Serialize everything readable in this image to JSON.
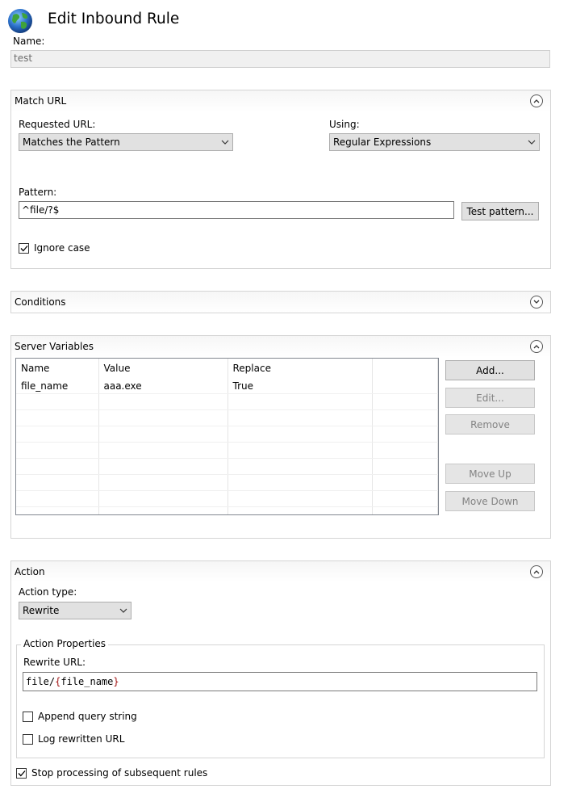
{
  "window": {
    "title": "Edit Inbound Rule",
    "icon": "globe-icon"
  },
  "name": {
    "label": "Name:",
    "value": "test"
  },
  "match_url": {
    "header": "Match URL",
    "requested_url_label": "Requested URL:",
    "requested_url_value": "Matches the Pattern",
    "using_label": "Using:",
    "using_value": "Regular Expressions",
    "pattern_label": "Pattern:",
    "pattern_value": "^file/?$",
    "test_pattern_button": "Test pattern...",
    "ignore_case_label": "Ignore case",
    "ignore_case_checked": true
  },
  "conditions": {
    "header": "Conditions"
  },
  "server_variables": {
    "header": "Server Variables",
    "columns": [
      "Name",
      "Value",
      "Replace"
    ],
    "rows": [
      {
        "name": "file_name",
        "value": "aaa.exe",
        "replace": "True"
      }
    ],
    "buttons": {
      "add": "Add...",
      "edit": "Edit...",
      "remove": "Remove",
      "move_up": "Move Up",
      "move_down": "Move Down"
    }
  },
  "action": {
    "header": "Action",
    "action_type_label": "Action type:",
    "action_type_value": "Rewrite",
    "properties_legend": "Action Properties",
    "rewrite_url_label": "Rewrite URL:",
    "rewrite_url_prefix": "file/",
    "rewrite_url_var_open": "{",
    "rewrite_url_var_name": "file_name",
    "rewrite_url_var_close": "}",
    "append_query_label": "Append query string",
    "append_query_checked": false,
    "log_rewritten_label": "Log rewritten URL",
    "log_rewritten_checked": false,
    "stop_processing_label": "Stop processing of subsequent rules",
    "stop_processing_checked": true
  },
  "colors": {
    "accent_var": "#a31515",
    "globe_ocean": "#2a6fc9",
    "globe_land": "#3fa33b"
  }
}
